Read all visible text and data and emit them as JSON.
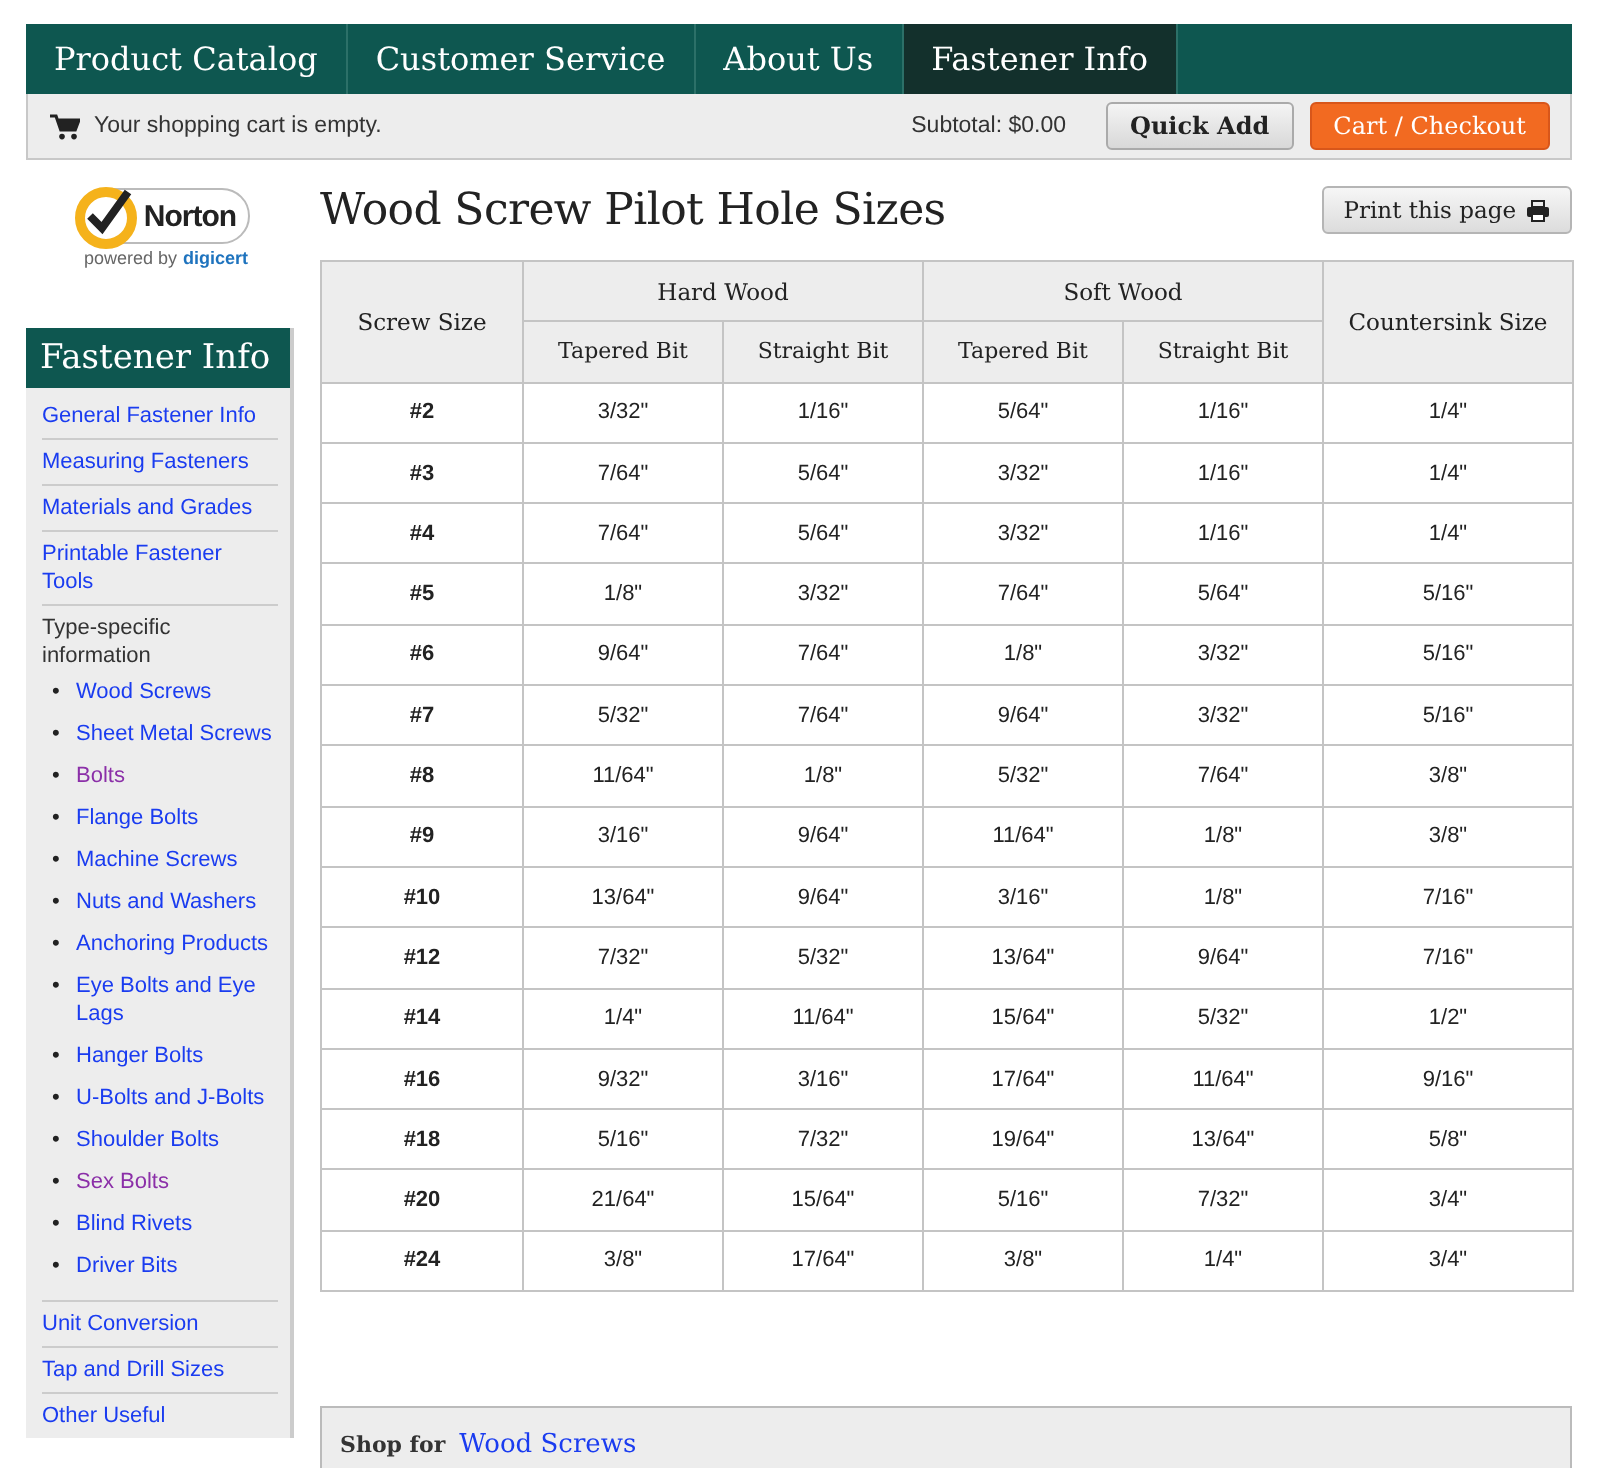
{
  "nav": {
    "tabs": [
      {
        "label": "Product Catalog",
        "selected": false
      },
      {
        "label": "Customer Service",
        "selected": false
      },
      {
        "label": "About Us",
        "selected": false
      },
      {
        "label": "Fastener Info",
        "selected": true
      }
    ]
  },
  "cart_bar": {
    "message": "Your shopping cart is empty.",
    "subtotal": "Subtotal: $0.00",
    "buttons": [
      {
        "label": "Quick Add",
        "kind": "plain"
      },
      {
        "label": "Cart / Checkout",
        "kind": "primary"
      }
    ]
  },
  "seal": {
    "name": "Norton",
    "powered_by": "powered by",
    "provider": "digicert"
  },
  "sidebar": {
    "title": "Fastener Info",
    "items": [
      {
        "kind": "link",
        "label": "General Fastener Info",
        "visited": false
      },
      {
        "kind": "link",
        "label": "Measuring Fasteners",
        "visited": false
      },
      {
        "kind": "link",
        "label": "Materials and Grades",
        "visited": false
      },
      {
        "kind": "link",
        "label": "Printable Fastener Tools",
        "visited": false
      },
      {
        "kind": "group",
        "label": "Type-specific information",
        "marker": "•",
        "children": [
          {
            "label": "Wood Screws",
            "visited": false
          },
          {
            "label": "Sheet Metal Screws",
            "visited": false
          },
          {
            "label": "Bolts",
            "visited": true
          },
          {
            "label": "Flange Bolts",
            "visited": false
          },
          {
            "label": "Machine Screws",
            "visited": false
          },
          {
            "label": "Nuts and Washers",
            "visited": false
          },
          {
            "label": "Anchoring Products",
            "visited": false
          },
          {
            "label": "Eye Bolts and Eye Lags",
            "visited": false
          },
          {
            "label": "Hanger Bolts",
            "visited": false
          },
          {
            "label": "U-Bolts and J-Bolts",
            "visited": false
          },
          {
            "label": "Shoulder Bolts",
            "visited": false
          },
          {
            "label": "Sex Bolts",
            "visited": true
          },
          {
            "label": "Blind Rivets",
            "visited": false
          },
          {
            "label": "Driver Bits",
            "visited": false
          }
        ]
      },
      {
        "kind": "link",
        "label": "Unit Conversion",
        "visited": false
      },
      {
        "kind": "link",
        "label": "Tap and Drill Sizes",
        "visited": false
      },
      {
        "kind": "link",
        "label": "Other Useful",
        "visited": false
      }
    ]
  },
  "page": {
    "title": "Wood Screw Pilot Hole Sizes",
    "print_button": "Print this page"
  },
  "table": {
    "first_column": "Screw Size",
    "groups": [
      {
        "label": "Hard Wood",
        "columns": [
          "Tapered Bit",
          "Straight Bit"
        ]
      },
      {
        "label": "Soft Wood",
        "columns": [
          "Tapered Bit",
          "Straight Bit"
        ]
      }
    ],
    "last_column": "Countersink Size",
    "rows": [
      [
        "#2",
        "3/32\"",
        "1/16\"",
        "5/64\"",
        "1/16\"",
        "1/4\""
      ],
      [
        "#3",
        "7/64\"",
        "5/64\"",
        "3/32\"",
        "1/16\"",
        "1/4\""
      ],
      [
        "#4",
        "7/64\"",
        "5/64\"",
        "3/32\"",
        "1/16\"",
        "1/4\""
      ],
      [
        "#5",
        "1/8\"",
        "3/32\"",
        "7/64\"",
        "5/64\"",
        "5/16\""
      ],
      [
        "#6",
        "9/64\"",
        "7/64\"",
        "1/8\"",
        "3/32\"",
        "5/16\""
      ],
      [
        "#7",
        "5/32\"",
        "7/64\"",
        "9/64\"",
        "3/32\"",
        "5/16\""
      ],
      [
        "#8",
        "11/64\"",
        "1/8\"",
        "5/32\"",
        "7/64\"",
        "3/8\""
      ],
      [
        "#9",
        "3/16\"",
        "9/64\"",
        "11/64\"",
        "1/8\"",
        "3/8\""
      ],
      [
        "#10",
        "13/64\"",
        "9/64\"",
        "3/16\"",
        "1/8\"",
        "7/16\""
      ],
      [
        "#12",
        "7/32\"",
        "5/32\"",
        "13/64\"",
        "9/64\"",
        "7/16\""
      ],
      [
        "#14",
        "1/4\"",
        "11/64\"",
        "15/64\"",
        "5/32\"",
        "1/2\""
      ],
      [
        "#16",
        "9/32\"",
        "3/16\"",
        "17/64\"",
        "11/64\"",
        "9/16\""
      ],
      [
        "#18",
        "5/16\"",
        "7/32\"",
        "19/64\"",
        "13/64\"",
        "5/8\""
      ],
      [
        "#20",
        "21/64\"",
        "15/64\"",
        "5/16\"",
        "7/32\"",
        "3/4\""
      ],
      [
        "#24",
        "3/8\"",
        "17/64\"",
        "3/8\"",
        "1/4\"",
        "3/4\""
      ]
    ]
  },
  "shop_box": {
    "label": "Shop for",
    "link": "Wood Screws"
  }
}
